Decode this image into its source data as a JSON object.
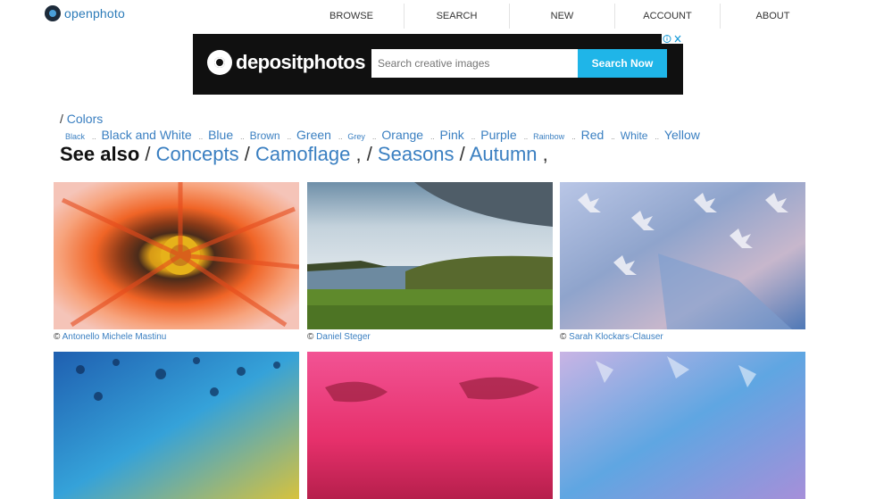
{
  "site": {
    "logo_text": "openphoto"
  },
  "nav": [
    "BROWSE",
    "SEARCH",
    "NEW",
    "ACCOUNT",
    "ABOUT"
  ],
  "ad": {
    "brand": "depositphotos",
    "search_placeholder": "Search creative images",
    "search_button": "Search Now",
    "info_icon": "i-close-icon"
  },
  "breadcrumb": {
    "sep": "/",
    "label": "Colors"
  },
  "colors": [
    {
      "label": "Black",
      "size": "small"
    },
    {
      "label": "Black and White",
      "size": "large"
    },
    {
      "label": "Blue",
      "size": "large"
    },
    {
      "label": "Brown",
      "size": "medium"
    },
    {
      "label": "Green",
      "size": "large"
    },
    {
      "label": "Grey",
      "size": "small"
    },
    {
      "label": "Orange",
      "size": "large"
    },
    {
      "label": "Pink",
      "size": "large"
    },
    {
      "label": "Purple",
      "size": "large"
    },
    {
      "label": "Rainbow",
      "size": "small"
    },
    {
      "label": "Red",
      "size": "large"
    },
    {
      "label": "White",
      "size": "medium"
    },
    {
      "label": "Yellow",
      "size": "large"
    }
  ],
  "color_sep": "..",
  "see_also": {
    "label": "See also",
    "links": [
      "Concepts",
      "Camoflage",
      "Seasons",
      "Autumn"
    ]
  },
  "photos": [
    {
      "credit": "Antonello Michele Mastinu"
    },
    {
      "credit": "Daniel Steger"
    },
    {
      "credit": "Sarah Klockars-Clauser"
    },
    {
      "credit": ""
    },
    {
      "credit": ""
    },
    {
      "credit": ""
    }
  ],
  "copyright_symbol": "©"
}
